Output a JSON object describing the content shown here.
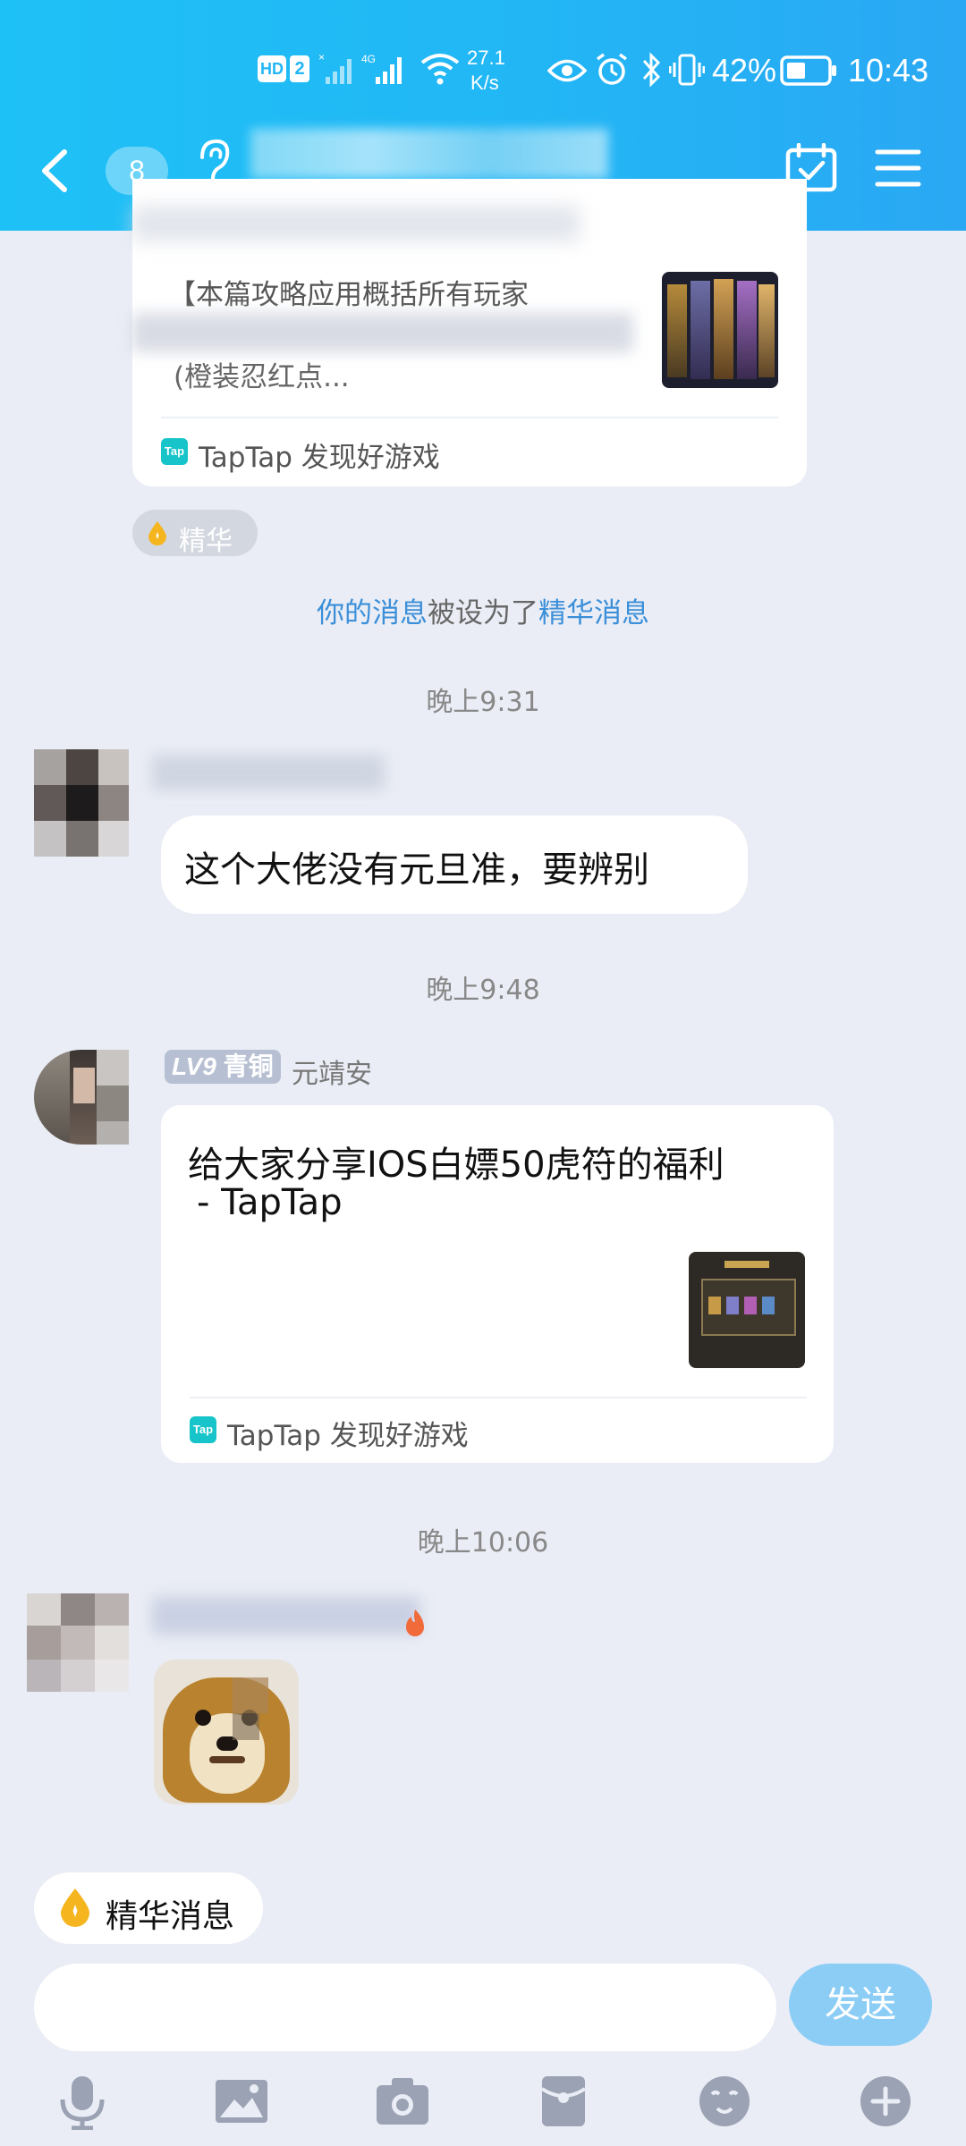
{
  "status_bar": {
    "network_speed_value": "27.1",
    "network_speed_unit": "K/s",
    "battery": "42%",
    "time": "10:43"
  },
  "nav": {
    "unread_count": "8"
  },
  "shared_card_top": {
    "excerpt_line1": "【本篇攻略应用概括所有玩家",
    "excerpt_line3": "(橙装忍红点...",
    "source": "TapTap 发现好游戏"
  },
  "essence_tag": "精华",
  "system_notice": {
    "part1": "你的消息",
    "part2": "被设为了",
    "part3": "精华消息"
  },
  "timestamps": [
    "晚上9:31",
    "晚上9:48",
    "晚上10:06"
  ],
  "messages": [
    {
      "text": "这个大佬没有元旦准，要辨别"
    },
    {
      "level": "LV9",
      "rank": "青铜",
      "sender": "元靖安",
      "card_title_line1": "给大家分享IOS白嫖50虎符的福利",
      "card_title_line2": "- TapTap",
      "source": "TapTap 发现好游戏"
    }
  ],
  "bottom": {
    "essence_button": "精华消息",
    "send_button": "发送",
    "toolbar": [
      "mic-icon",
      "image-icon",
      "camera-icon",
      "red-packet-icon",
      "emoji-icon",
      "plus-icon"
    ]
  },
  "colors": {
    "header": "#22b6f5",
    "link_blue": "#3b8fd9",
    "page_bg": "#eaedf5",
    "send_button": "#8ccdf6"
  }
}
